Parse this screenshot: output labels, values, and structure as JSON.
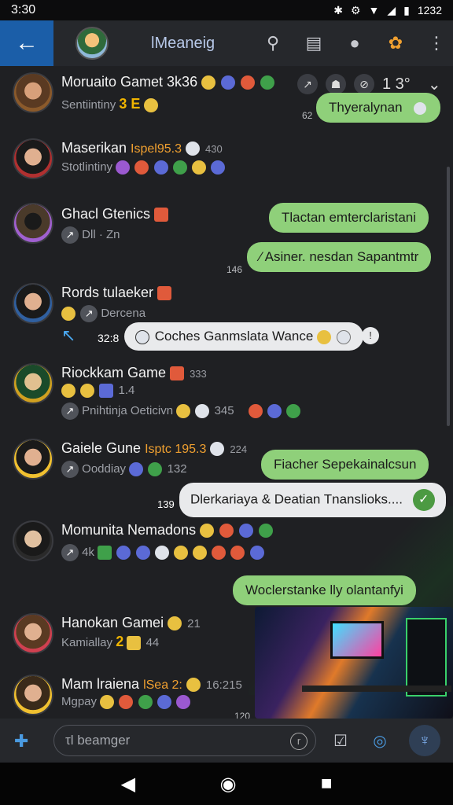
{
  "status_bar": {
    "time": "3:30",
    "battery": "1232"
  },
  "header": {
    "title": "lMeaneig"
  },
  "chats": [
    {
      "name": "Moruaito Gamet 3k36",
      "sub": "Sentiintiny",
      "sub_badge": "3 E",
      "right_time": "1 3°",
      "right_num": "62",
      "bubble": "Thyeralynan"
    },
    {
      "name": "Maserikan",
      "tag": "Ispel95.3",
      "num": "430",
      "sub": "Stotlintiny"
    },
    {
      "name": "Ghacl Gtenics",
      "sub": "Dll · Zn",
      "bubbles": [
        "Tlactan emterclaristani",
        "⁄ Asiner. nesdan Sapantmtr"
      ],
      "bubble_time": "146"
    },
    {
      "name": "Rords tulaeker",
      "sub": "Dercena",
      "time": "32:8",
      "white_bubble": "Coches Ganmslata Wance"
    },
    {
      "name": "Riockkam Game",
      "num": "333",
      "sub_num": "1.4",
      "sub": "Pnihtinja Oeticivn",
      "sub_num2": "345"
    },
    {
      "name": "Gaiele Gune",
      "tag": "Isptc 195.3",
      "num": "224",
      "sub": "Ooddiay",
      "sub_num": "132",
      "bubble": "Fiacher Sepekainalcsun",
      "time2": "139",
      "white_bubble": "Dlerkariaya & Deatian Tnanslioks...."
    },
    {
      "name": "Momunita Nemadons",
      "sub_num": "4k"
    },
    {
      "bubble": "Woclerstanke lly olantanfyi"
    },
    {
      "name": "Hanokan Gamei",
      "num": "21",
      "sub": "Kamiallay",
      "sub_badge": "2",
      "sub_num": "44"
    },
    {
      "name": "Mam lraiena",
      "tag": "lSea 2:",
      "num": "16:215",
      "sub": "Mgpay",
      "photo_num": "120"
    }
  ],
  "input": {
    "placeholder": "τl beamger"
  }
}
